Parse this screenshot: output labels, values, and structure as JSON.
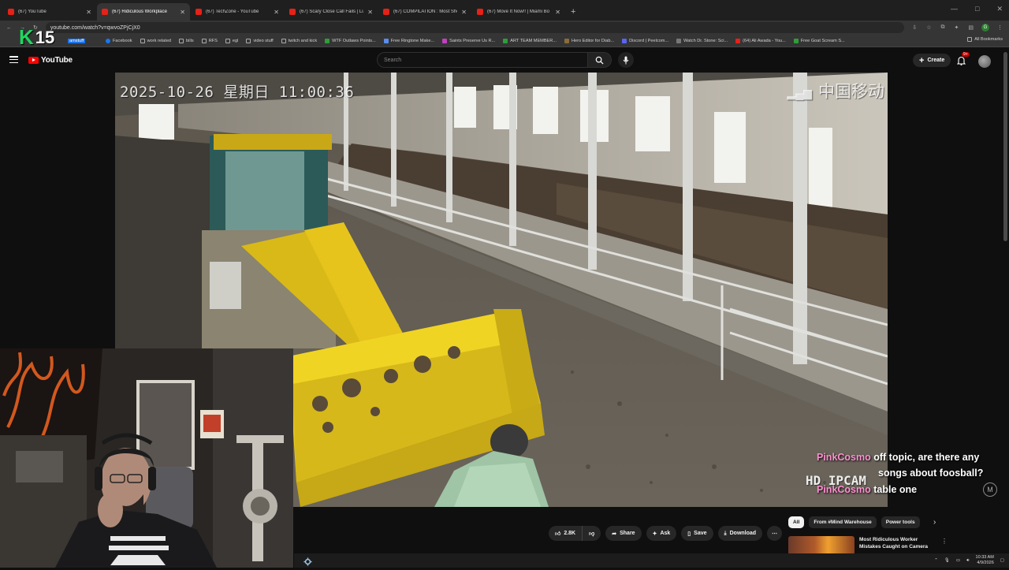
{
  "browser": {
    "tabs": [
      {
        "label": "(67) YouTube",
        "active": false
      },
      {
        "label": "(67) Ridiculous Workplace",
        "active": true
      },
      {
        "label": "(67) TechZone - YouTube",
        "active": false
      },
      {
        "label": "(67) Scary Close Call Fails | Luck",
        "active": false
      },
      {
        "label": "(67) COMPILATION : Most Sho",
        "active": false
      },
      {
        "label": "(67) Move It Now!! | Miami Bo",
        "active": false
      }
    ],
    "url": "youtube.com/watch?v=qwvoZPjCjX0",
    "bookmarks": [
      "Facebook",
      "work related",
      "bills",
      "RFS",
      "egl",
      "video stuff",
      "twitch and kick",
      "WTF Outlaws Points...",
      "Free Ringtone Make...",
      "Saints Preserve Us R...",
      "ART TEAM MEMBER...",
      "Hero Editor for Diab...",
      "Discord | Peelcom...",
      "Watch Dr. Stone: Sci...",
      "(64) Ali Awada - You...",
      "Free Goat Scream S..."
    ],
    "all_bookmarks": "All Bookmarks",
    "bookmark_partial": "amstuff"
  },
  "overlay": {
    "logo_letter": "K",
    "logo_number": "15"
  },
  "youtube": {
    "logo_text": "YouTube",
    "search_placeholder": "Search",
    "create_label": "Create",
    "notif_badge": "9+"
  },
  "video": {
    "osd_timestamp": "2025-10-26 星期日 11:00:36",
    "osd_carrier": "中国移动",
    "osd_camera": "HD IPCAM"
  },
  "chat": [
    {
      "name": "PinkCosmo",
      "message": "off topic, are there any"
    },
    {
      "name": "",
      "message": "songs about foosball?"
    },
    {
      "name": "PinkCosmo",
      "message": "table one"
    }
  ],
  "actions": {
    "like_count": "2.8K",
    "share": "Share",
    "ask": "Ask",
    "save": "Save",
    "download": "Download"
  },
  "chips": [
    "All",
    "From #Mind Warehouse",
    "Power tools"
  ],
  "recommendation": {
    "title_line1": "Most Ridiculous Worker",
    "title_line2": "Mistakes Caught on Camera"
  },
  "taskbar": {
    "time": "10:33 AM",
    "date": "4/9/2026"
  },
  "colors": {
    "chat_name": "#ff8fd0",
    "logo_green": "#1ed760",
    "yt_red": "#ff0000",
    "bucket_yellow": "#f2d21a"
  }
}
